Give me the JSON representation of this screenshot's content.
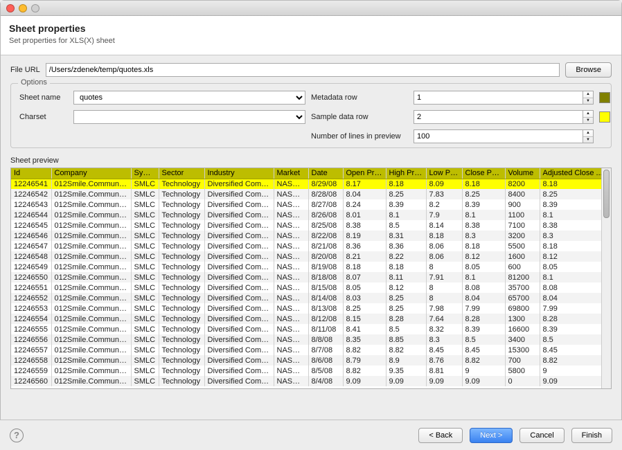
{
  "header": {
    "title": "Sheet properties",
    "subtitle": "Set properties for XLS(X) sheet"
  },
  "file": {
    "label": "File URL",
    "value": "/Users/zdenek/temp/quotes.xls",
    "browse": "Browse"
  },
  "options": {
    "legend": "Options",
    "sheet_label": "Sheet name",
    "sheet_value": "quotes",
    "charset_label": "Charset",
    "charset_value": "",
    "meta_label": "Metadata row",
    "meta_value": "1",
    "sample_label": "Sample data row",
    "sample_value": "2",
    "lines_label": "Number of lines in preview",
    "lines_value": "100"
  },
  "preview": {
    "label": "Sheet preview",
    "columns": [
      "Id",
      "Company",
      "Symbol",
      "Sector",
      "Industry",
      "Market",
      "Date",
      "Open Price",
      "High Price",
      "Low Price",
      "Close Price",
      "Volume",
      "Adjusted Close ..."
    ],
    "rows": [
      [
        "12246541",
        "012Smile.Commun…",
        "SMLC",
        "Technology",
        "Diversified Com…",
        "NASDAQ",
        "8/29/08",
        "8.17",
        "8.18",
        "8.09",
        "8.18",
        "8200",
        "8.18"
      ],
      [
        "12246542",
        "012Smile.Commun…",
        "SMLC",
        "Technology",
        "Diversified Com…",
        "NASDAQ",
        "8/28/08",
        "8.04",
        "8.25",
        "7.83",
        "8.25",
        "8400",
        "8.25"
      ],
      [
        "12246543",
        "012Smile.Commun…",
        "SMLC",
        "Technology",
        "Diversified Com…",
        "NASDAQ",
        "8/27/08",
        "8.24",
        "8.39",
        "8.2",
        "8.39",
        "900",
        "8.39"
      ],
      [
        "12246544",
        "012Smile.Commun…",
        "SMLC",
        "Technology",
        "Diversified Com…",
        "NASDAQ",
        "8/26/08",
        "8.01",
        "8.1",
        "7.9",
        "8.1",
        "1100",
        "8.1"
      ],
      [
        "12246545",
        "012Smile.Commun…",
        "SMLC",
        "Technology",
        "Diversified Com…",
        "NASDAQ",
        "8/25/08",
        "8.38",
        "8.5",
        "8.14",
        "8.38",
        "7100",
        "8.38"
      ],
      [
        "12246546",
        "012Smile.Commun…",
        "SMLC",
        "Technology",
        "Diversified Com…",
        "NASDAQ",
        "8/22/08",
        "8.19",
        "8.31",
        "8.18",
        "8.3",
        "3200",
        "8.3"
      ],
      [
        "12246547",
        "012Smile.Commun…",
        "SMLC",
        "Technology",
        "Diversified Com…",
        "NASDAQ",
        "8/21/08",
        "8.36",
        "8.36",
        "8.06",
        "8.18",
        "5500",
        "8.18"
      ],
      [
        "12246548",
        "012Smile.Commun…",
        "SMLC",
        "Technology",
        "Diversified Com…",
        "NASDAQ",
        "8/20/08",
        "8.21",
        "8.22",
        "8.06",
        "8.12",
        "1600",
        "8.12"
      ],
      [
        "12246549",
        "012Smile.Commun…",
        "SMLC",
        "Technology",
        "Diversified Com…",
        "NASDAQ",
        "8/19/08",
        "8.18",
        "8.18",
        "8",
        "8.05",
        "600",
        "8.05"
      ],
      [
        "12246550",
        "012Smile.Commun…",
        "SMLC",
        "Technology",
        "Diversified Com…",
        "NASDAQ",
        "8/18/08",
        "8.07",
        "8.11",
        "7.91",
        "8.1",
        "81200",
        "8.1"
      ],
      [
        "12246551",
        "012Smile.Commun…",
        "SMLC",
        "Technology",
        "Diversified Com…",
        "NASDAQ",
        "8/15/08",
        "8.05",
        "8.12",
        "8",
        "8.08",
        "35700",
        "8.08"
      ],
      [
        "12246552",
        "012Smile.Commun…",
        "SMLC",
        "Technology",
        "Diversified Com…",
        "NASDAQ",
        "8/14/08",
        "8.03",
        "8.25",
        "8",
        "8.04",
        "65700",
        "8.04"
      ],
      [
        "12246553",
        "012Smile.Commun…",
        "SMLC",
        "Technology",
        "Diversified Com…",
        "NASDAQ",
        "8/13/08",
        "8.25",
        "8.25",
        "7.98",
        "7.99",
        "69800",
        "7.99"
      ],
      [
        "12246554",
        "012Smile.Commun…",
        "SMLC",
        "Technology",
        "Diversified Com…",
        "NASDAQ",
        "8/12/08",
        "8.15",
        "8.28",
        "7.64",
        "8.28",
        "1300",
        "8.28"
      ],
      [
        "12246555",
        "012Smile.Commun…",
        "SMLC",
        "Technology",
        "Diversified Com…",
        "NASDAQ",
        "8/11/08",
        "8.41",
        "8.5",
        "8.32",
        "8.39",
        "16600",
        "8.39"
      ],
      [
        "12246556",
        "012Smile.Commun…",
        "SMLC",
        "Technology",
        "Diversified Com…",
        "NASDAQ",
        "8/8/08",
        "8.35",
        "8.85",
        "8.3",
        "8.5",
        "3400",
        "8.5"
      ],
      [
        "12246557",
        "012Smile.Commun…",
        "SMLC",
        "Technology",
        "Diversified Com…",
        "NASDAQ",
        "8/7/08",
        "8.82",
        "8.82",
        "8.45",
        "8.45",
        "15300",
        "8.45"
      ],
      [
        "12246558",
        "012Smile.Commun…",
        "SMLC",
        "Technology",
        "Diversified Com…",
        "NASDAQ",
        "8/6/08",
        "8.79",
        "8.9",
        "8.76",
        "8.82",
        "700",
        "8.82"
      ],
      [
        "12246559",
        "012Smile.Commun…",
        "SMLC",
        "Technology",
        "Diversified Com…",
        "NASDAQ",
        "8/5/08",
        "8.82",
        "9.35",
        "8.81",
        "9",
        "5800",
        "9"
      ],
      [
        "12246560",
        "012Smile.Commun…",
        "SMLC",
        "Technology",
        "Diversified Com…",
        "NASDAQ",
        "8/4/08",
        "9.09",
        "9.09",
        "9.09",
        "9.09",
        "0",
        "9.09"
      ]
    ]
  },
  "footer": {
    "back": "< Back",
    "next": "Next >",
    "cancel": "Cancel",
    "finish": "Finish"
  }
}
